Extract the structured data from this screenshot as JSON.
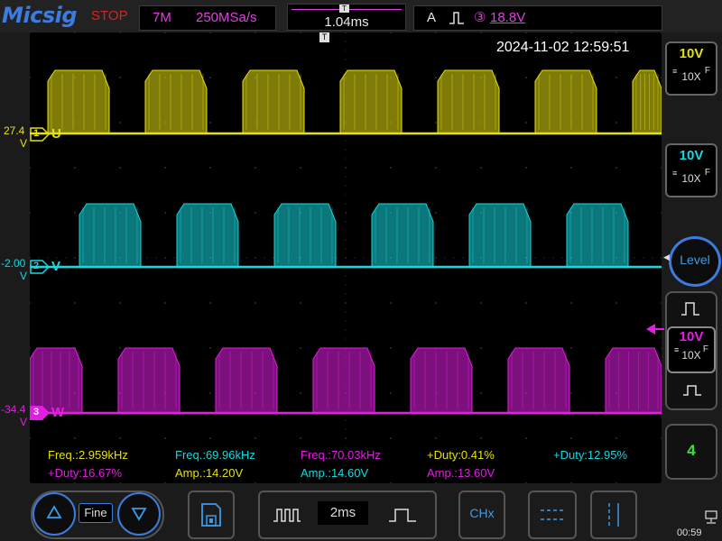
{
  "brand": {
    "logo": "Micsig",
    "status": "STOP"
  },
  "acquisition": {
    "memory_depth": "7M",
    "sample_rate": "250MSa/s"
  },
  "timebase": {
    "trigger_position": "1.04ms",
    "horizontal_scale": "2ms"
  },
  "trigger": {
    "mode": "A",
    "source": "③",
    "level": "18.8V"
  },
  "timestamp": "2024-11-02 12:59:51",
  "channels": [
    {
      "id": "1",
      "label": "U",
      "offset_value": "27.4",
      "offset_unit": "V",
      "color": "#e5e010",
      "scale": "10V",
      "probe": "10X",
      "coupling": "F"
    },
    {
      "id": "2",
      "label": "V",
      "offset_value": "-2.00",
      "offset_unit": "V",
      "color": "#16d8de",
      "scale": "10V",
      "probe": "10X",
      "coupling": "F"
    },
    {
      "id": "3",
      "label": "W",
      "offset_value": "-34.4",
      "offset_unit": "V",
      "color": "#e21ee2",
      "scale": "10V",
      "probe": "10X",
      "coupling": "F"
    }
  ],
  "measurements": {
    "row1": [
      {
        "text": "Freq.:2.959kHz",
        "color": "#e5e010"
      },
      {
        "text": "Freq.:69.96kHz",
        "color": "#16d8de"
      },
      {
        "text": "Freq.:70.03kHz",
        "color": "#e21ee2"
      },
      {
        "text": "+Duty:0.41%",
        "color": "#e5e010"
      },
      {
        "text": "+Duty:12.95%",
        "color": "#16d8de"
      }
    ],
    "row2": [
      {
        "text": "+Duty:16.67%",
        "color": "#e21ee2"
      },
      {
        "text": "Amp.:14.20V",
        "color": "#e5e010"
      },
      {
        "text": "Amp.:14.60V",
        "color": "#16d8de"
      },
      {
        "text": "Amp.:13.60V",
        "color": "#e21ee2"
      }
    ]
  },
  "side_panel": {
    "level_label": "Level",
    "auto_count": "4"
  },
  "bottom": {
    "fine_label": "Fine",
    "chx_label": "CHx",
    "clock": "00:59"
  },
  "icons": {
    "save": "save-icon",
    "up": "triangle-up-icon",
    "down": "triangle-down-icon",
    "cursor": "cursor-icon"
  }
}
